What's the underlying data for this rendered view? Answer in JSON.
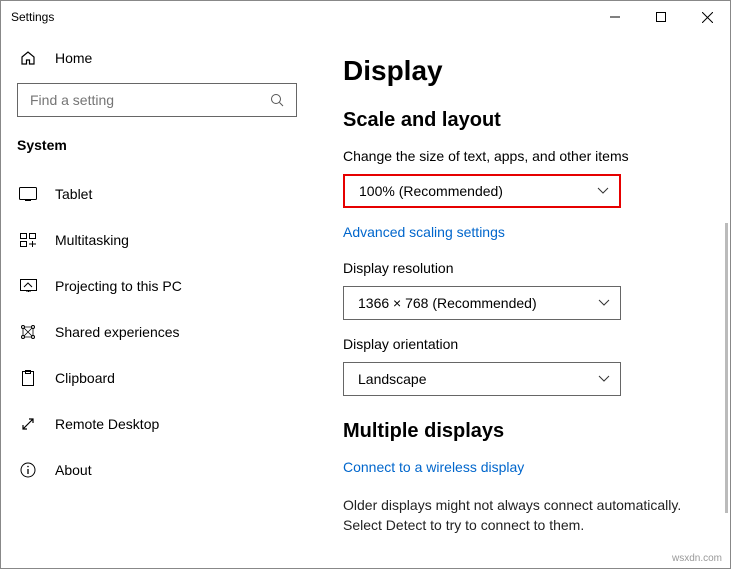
{
  "window": {
    "title": "Settings"
  },
  "sidebar": {
    "home": "Home",
    "search_placeholder": "Find a setting",
    "category": "System",
    "items": [
      {
        "label": "Tablet"
      },
      {
        "label": "Multitasking"
      },
      {
        "label": "Projecting to this PC"
      },
      {
        "label": "Shared experiences"
      },
      {
        "label": "Clipboard"
      },
      {
        "label": "Remote Desktop"
      },
      {
        "label": "About"
      }
    ]
  },
  "main": {
    "title": "Display",
    "section_scale": "Scale and layout",
    "scale_label": "Change the size of text, apps, and other items",
    "scale_value": "100% (Recommended)",
    "advanced_link": "Advanced scaling settings",
    "resolution_label": "Display resolution",
    "resolution_value": "1366 × 768 (Recommended)",
    "orientation_label": "Display orientation",
    "orientation_value": "Landscape",
    "section_multi": "Multiple displays",
    "wireless_link": "Connect to a wireless display",
    "older_text": "Older displays might not always connect automatically. Select Detect to try to connect to them."
  },
  "watermark": "wsxdn.com"
}
